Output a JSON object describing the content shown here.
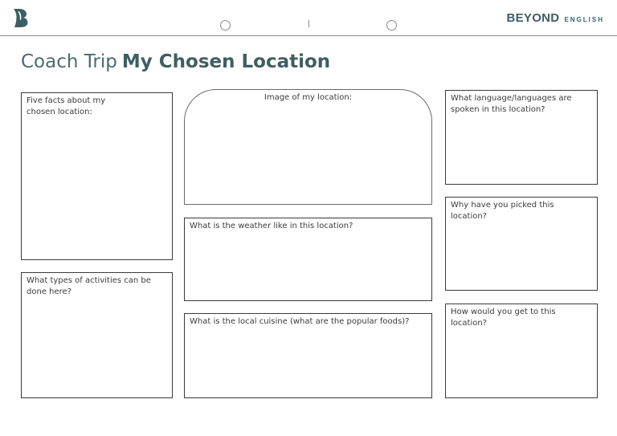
{
  "header": {
    "logo_letter": "B",
    "brand_main": "BEYOND",
    "brand_sub": "ENGLISH",
    "accent_color": "#3d5e63"
  },
  "title": {
    "light": "Coach Trip",
    "bold": "My Chosen Location"
  },
  "boxes": {
    "five_facts": "Five facts about my\nchosen location:",
    "activities": "What types of activities can be\ndone here?",
    "image": "Image of my location:",
    "weather": "What is the weather like in this location?",
    "cuisine": "What is the local cuisine (what are the popular foods)?",
    "language": "What language/languages are\nspoken in this location?",
    "why": "Why have you picked this location?",
    "how": "How would you get to this location?"
  }
}
